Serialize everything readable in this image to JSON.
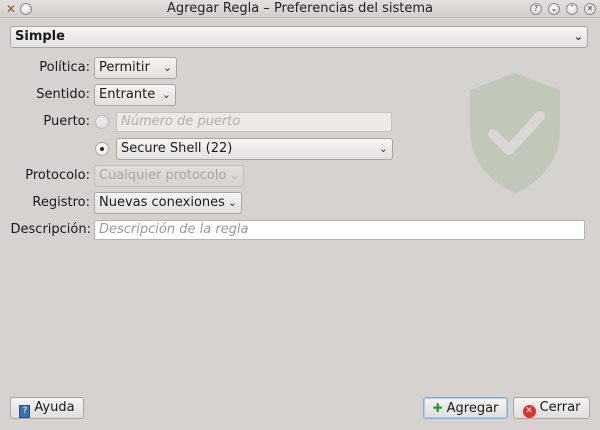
{
  "window": {
    "title": "Agregar Regla – Preferencias del sistema",
    "buttons": [
      "?",
      "v",
      "^",
      "x"
    ]
  },
  "mode": {
    "selected": "Simple"
  },
  "form": {
    "politica": {
      "label": "Política:",
      "value": "Permitir"
    },
    "sentido": {
      "label": "Sentido:",
      "value": "Entrante"
    },
    "puerto": {
      "label": "Puerto:",
      "manual_placeholder": "Número de puerto",
      "manual_checked": false,
      "service_checked": true,
      "service_value": "Secure Shell (22)"
    },
    "protocolo": {
      "label": "Protocolo:",
      "value": "Cualquier protocolo",
      "enabled": false
    },
    "registro": {
      "label": "Registro:",
      "value": "Nuevas conexiones"
    },
    "descripcion": {
      "label": "Descripción:",
      "placeholder": "Descripción de la regla"
    }
  },
  "footer": {
    "help_label": "Ayuda",
    "add_label": "Agregar",
    "cancel_label": "Cerrar"
  },
  "icons": {
    "help": "help-book-icon",
    "add": "plus-icon",
    "cancel": "cancel-icon",
    "watermark": "shield-check-icon"
  }
}
